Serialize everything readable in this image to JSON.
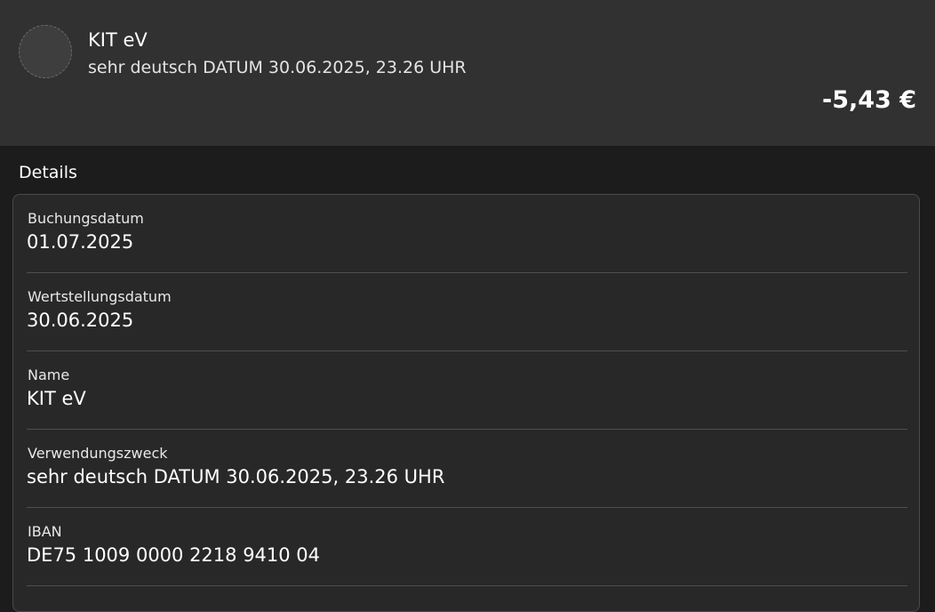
{
  "header": {
    "avatar_icon": "merchant-avatar-placeholder",
    "name": "KIT eV",
    "purpose": "sehr deutsch DATUM 30.06.2025, 23.26 UHR",
    "amount": "-5,43 €"
  },
  "details": {
    "title": "Details",
    "rows": [
      {
        "label": "Buchungsdatum",
        "value": "01.07.2025"
      },
      {
        "label": "Wertstellungsdatum",
        "value": "30.06.2025"
      },
      {
        "label": "Name",
        "value": "KIT eV"
      },
      {
        "label": "Verwendungszweck",
        "value": "sehr deutsch DATUM 30.06.2025, 23.26 UHR"
      },
      {
        "label": "IBAN",
        "value": "DE75 1009 0000 2218 9410 04"
      }
    ]
  }
}
